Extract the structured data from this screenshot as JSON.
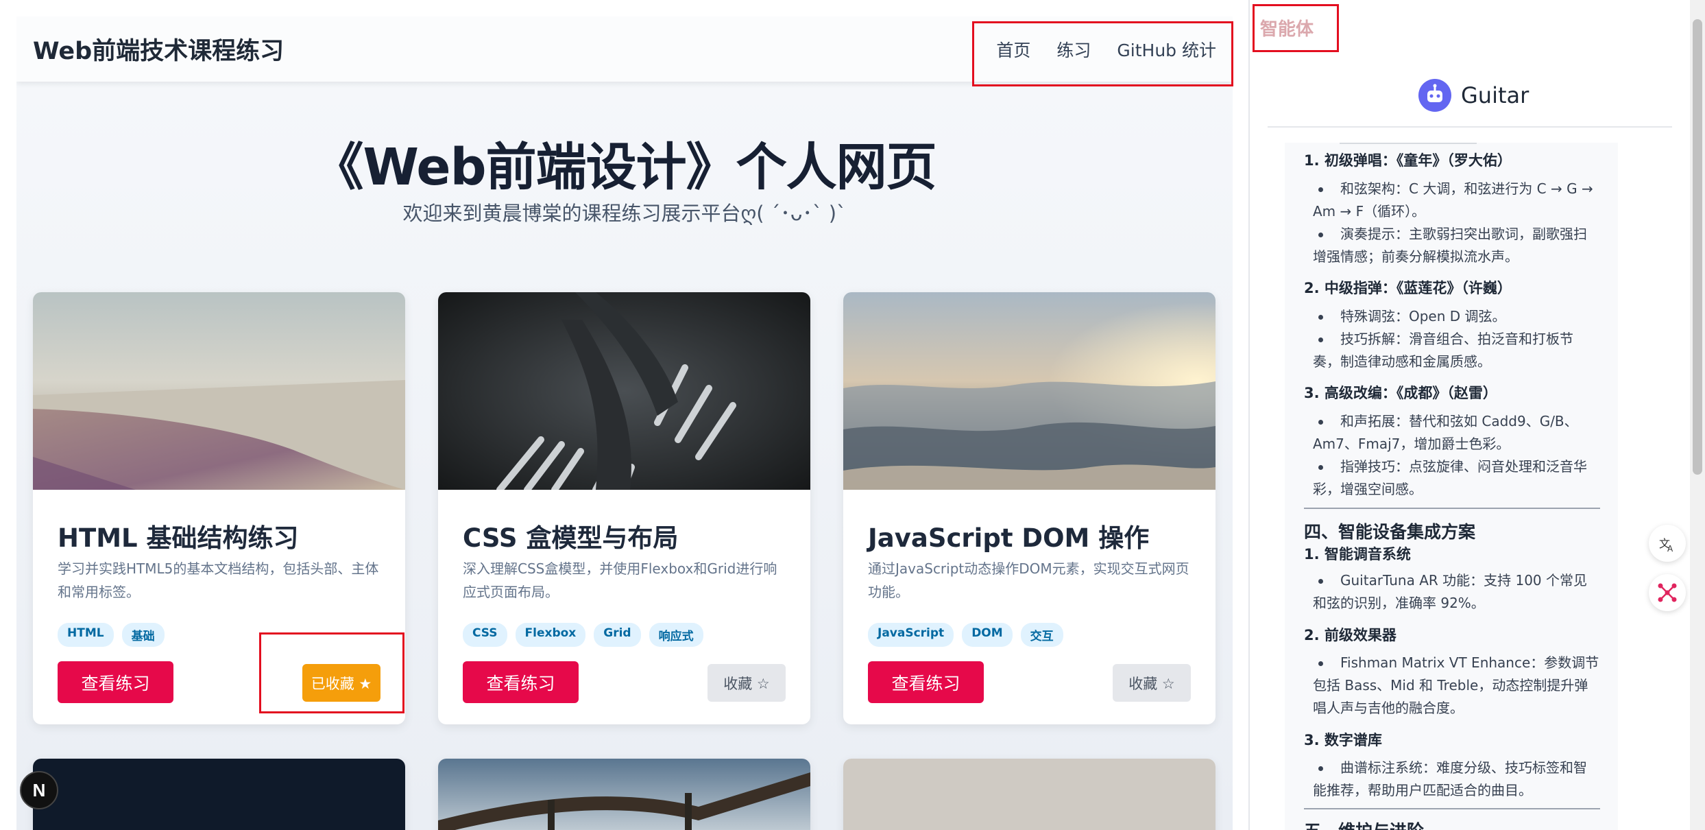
{
  "navbar": {
    "brand": "Web前端技术课程练习",
    "links": [
      "首页",
      "练习",
      "GitHub 统计"
    ]
  },
  "hero": {
    "title": "《Web前端设计》个人网页",
    "subtitle": "欢迎来到黄晨博棠的课程练习展示平台ღ( ´･ᴗ･` )`"
  },
  "cards": [
    {
      "title": "HTML 基础结构练习",
      "desc": "学习并实践HTML5的基本文档结构，包括头部、主体和常用标签。",
      "tags": [
        "HTML",
        "基础"
      ],
      "view_label": "查看练习",
      "fav_label": "已收藏 ★",
      "favorited": true
    },
    {
      "title": "CSS 盒模型与布局",
      "desc": "深入理解CSS盒模型，并使用Flexbox和Grid进行响应式页面布局。",
      "tags": [
        "CSS",
        "Flexbox",
        "Grid",
        "响应式"
      ],
      "view_label": "查看练习",
      "fav_label": "收藏 ☆",
      "favorited": false
    },
    {
      "title": "JavaScript DOM 操作",
      "desc": "通过JavaScript动态操作DOM元素，实现交互式网页功能。",
      "tags": [
        "JavaScript",
        "DOM",
        "交互"
      ],
      "view_label": "查看练习",
      "fav_label": "收藏 ☆",
      "favorited": false
    }
  ],
  "agent_panel": {
    "tab_label": "智能体",
    "bot_name": "Guitar",
    "chat": {
      "h1": "1. 初级弹唱：《童年》（罗大佑）",
      "h1_items": [
        "和弦架构：C 大调，和弦进行为 C → G → Am → F（循环）。",
        "演奏提示：主歌弱扫突出歌词，副歌强扫增强情感；前奏分解模拟流水声。"
      ],
      "h2": "2. 中级指弹：《蓝莲花》（许巍）",
      "h2_items": [
        "特殊调弦：Open D 调弦。",
        "技巧拆解：滑音组合、拍泛音和打板节奏，制造律动感和金属质感。"
      ],
      "h3": "3. 高级改编：《成都》（赵雷）",
      "h3_items": [
        "和声拓展：替代和弦如 Cadd9、G/B、Am7、Fmaj7，增加爵士色彩。",
        "指弹技巧：点弦旋律、闷音处理和泛音华彩，增强空间感。"
      ],
      "section4": "四、智能设备集成方案",
      "s4_h1": "1. 智能调音系统",
      "s4_h1_items": [
        "GuitarTuna AR 功能：支持 100 个常见和弦的识别，准确率 92%。"
      ],
      "s4_h2": "2. 前级效果器",
      "s4_h2_items": [
        "Fishman Matrix VT Enhance：参数调节包括 Bass、Mid 和 Treble，动态控制提升弹唱人声与吉他的融合度。"
      ],
      "s4_h3": "3. 数字谱库",
      "s4_h3_items": [
        "曲谱标注系统：难度分级、技巧标签和智能推荐，帮助用户匹配适合的曲目。"
      ],
      "section5": "五、维护与进阶"
    }
  },
  "badge": "N",
  "colors": {
    "primary_button": "#e6094a",
    "favorited_button": "#f59e0b",
    "annotation_box": "#e30e1f",
    "bot_avatar": "#6366f1"
  },
  "icons": [
    "translate-icon",
    "mindmap-icon",
    "robot-icon"
  ]
}
